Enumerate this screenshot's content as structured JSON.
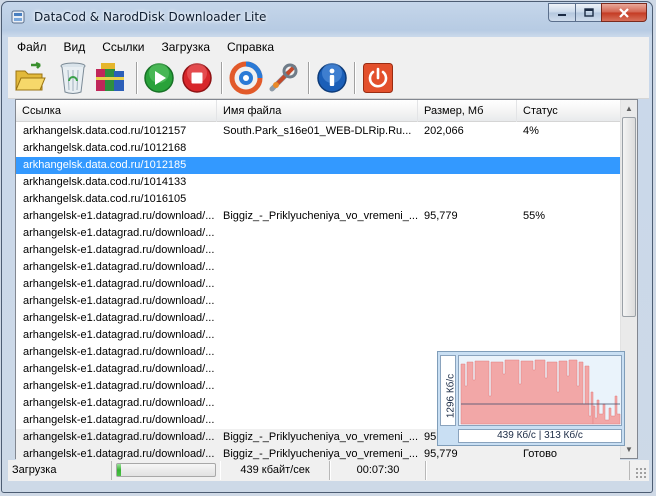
{
  "window": {
    "title": "DataCod & NarodDisk Downloader Lite"
  },
  "menu": [
    "Файл",
    "Вид",
    "Ссылки",
    "Загрузка",
    "Справка"
  ],
  "toolbar": [
    {
      "name": "open-folder-icon"
    },
    {
      "name": "recycle-bin-icon"
    },
    {
      "name": "archive-boxes-icon"
    },
    {
      "name": "start-play-icon"
    },
    {
      "name": "stop-icon"
    },
    {
      "name": "refresh-sync-icon"
    },
    {
      "name": "settings-tools-icon"
    },
    {
      "name": "info-icon"
    },
    {
      "name": "power-exit-icon"
    }
  ],
  "columns": [
    "Ссылка",
    "Имя файла",
    "Размер, Мб",
    "Статус"
  ],
  "rows": [
    {
      "link": "arkhangelsk.data.cod.ru/1012157",
      "file": "South.Park_s16e01_WEB-DLRip.Ru...",
      "size": "202,066",
      "status": "4%"
    },
    {
      "link": "arkhangelsk.data.cod.ru/1012168",
      "file": "",
      "size": "",
      "status": ""
    },
    {
      "link": "arkhangelsk.data.cod.ru/1012185",
      "file": "",
      "size": "",
      "status": ""
    },
    {
      "link": "arkhangelsk.data.cod.ru/1014133",
      "file": "",
      "size": "",
      "status": ""
    },
    {
      "link": "arkhangelsk.data.cod.ru/1016105",
      "file": "",
      "size": "",
      "status": ""
    },
    {
      "link": "arhangelsk-e1.datagrad.ru/download/...",
      "file": "Biggiz_-_Priklyucheniya_vo_vremeni_...",
      "size": "95,779",
      "status": "55%"
    },
    {
      "link": "arhangelsk-e1.datagrad.ru/download/...",
      "file": "",
      "size": "",
      "status": ""
    },
    {
      "link": "arhangelsk-e1.datagrad.ru/download/...",
      "file": "",
      "size": "",
      "status": ""
    },
    {
      "link": "arhangelsk-e1.datagrad.ru/download/...",
      "file": "",
      "size": "",
      "status": ""
    },
    {
      "link": "arhangelsk-e1.datagrad.ru/download/...",
      "file": "",
      "size": "",
      "status": ""
    },
    {
      "link": "arhangelsk-e1.datagrad.ru/download/...",
      "file": "",
      "size": "",
      "status": ""
    },
    {
      "link": "arhangelsk-e1.datagrad.ru/download/...",
      "file": "",
      "size": "",
      "status": ""
    },
    {
      "link": "arhangelsk-e1.datagrad.ru/download/...",
      "file": "",
      "size": "",
      "status": ""
    },
    {
      "link": "arhangelsk-e1.datagrad.ru/download/...",
      "file": "",
      "size": "",
      "status": ""
    },
    {
      "link": "arhangelsk-e1.datagrad.ru/download/...",
      "file": "",
      "size": "",
      "status": ""
    },
    {
      "link": "arhangelsk-e1.datagrad.ru/download/...",
      "file": "",
      "size": "",
      "status": ""
    },
    {
      "link": "arhangelsk-e1.datagrad.ru/download/...",
      "file": "",
      "size": "",
      "status": ""
    },
    {
      "link": "arhangelsk-e1.datagrad.ru/download/...",
      "file": "",
      "size": "",
      "status": ""
    },
    {
      "link": "arhangelsk-e1.datagrad.ru/download/...",
      "file": "Biggiz_-_Priklyucheniya_vo_vremeni_...",
      "size": "95,779",
      "status": ""
    },
    {
      "link": "arhangelsk-e1.datagrad.ru/download/...",
      "file": "Biggiz_-_Priklyucheniya_vo_vremeni_...",
      "size": "95,779",
      "status": "Готово"
    }
  ],
  "selected_row": 2,
  "graph": {
    "ylabel": "1296 Кб/с",
    "speed": "439 Кб/с | 313 Кб/с"
  },
  "status": {
    "label": "Загрузка",
    "progress": 0.04,
    "speed": "439 кбайт/сек",
    "time": "00:07:30"
  }
}
